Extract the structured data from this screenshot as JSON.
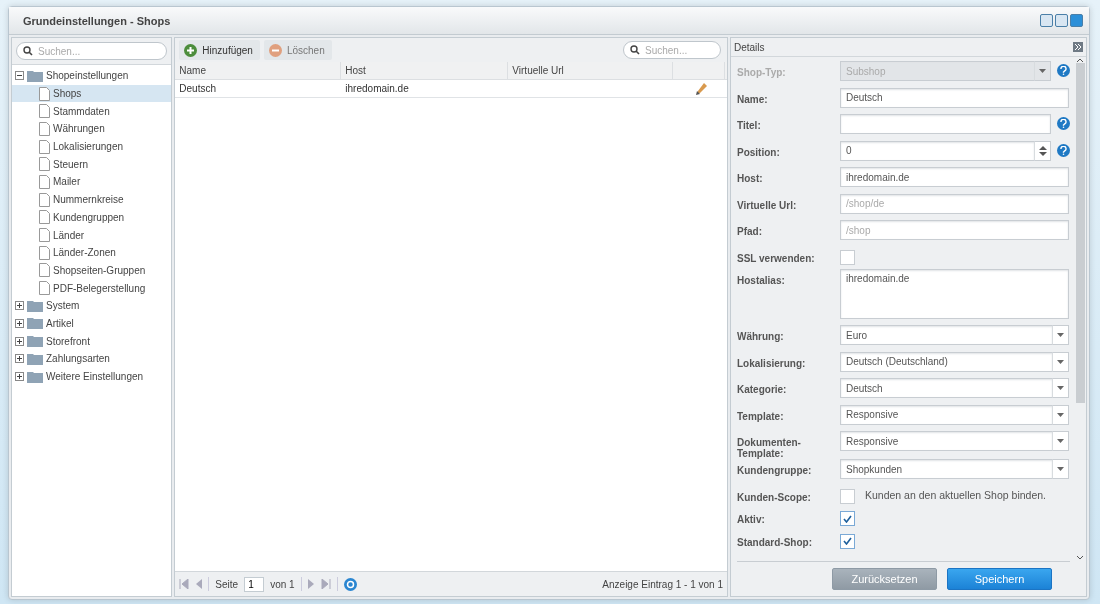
{
  "window": {
    "title": "Grundeinstellungen - Shops"
  },
  "tree": {
    "search": {
      "placeholder": "Suchen..."
    },
    "items": [
      {
        "label": "Shopeinstellungen",
        "expanded": true,
        "selected": false,
        "children": [
          {
            "label": "Shops",
            "selected": true
          },
          {
            "label": "Stammdaten",
            "selected": false
          },
          {
            "label": "Währungen",
            "selected": false
          },
          {
            "label": "Lokalisierungen",
            "selected": false
          },
          {
            "label": "Steuern",
            "selected": false
          },
          {
            "label": "Mailer",
            "selected": false
          },
          {
            "label": "Nummernkreise",
            "selected": false
          },
          {
            "label": "Kundengruppen",
            "selected": false
          },
          {
            "label": "Länder",
            "selected": false
          },
          {
            "label": "Länder-Zonen",
            "selected": false
          },
          {
            "label": "Shopseiten-Gruppen",
            "selected": false
          },
          {
            "label": "PDF-Belegerstellung",
            "selected": false
          }
        ]
      },
      {
        "label": "System",
        "expanded": false,
        "selected": false
      },
      {
        "label": "Artikel",
        "expanded": false,
        "selected": false
      },
      {
        "label": "Storefront",
        "expanded": false,
        "selected": false
      },
      {
        "label": "Zahlungsarten",
        "expanded": false,
        "selected": false
      },
      {
        "label": "Weitere Einstellungen",
        "expanded": false,
        "selected": false
      }
    ]
  },
  "toolbar": {
    "buttons": [
      {
        "label": "Hinzufügen",
        "kind": "add",
        "disabled": false
      },
      {
        "label": "Löschen",
        "kind": "delete",
        "disabled": true
      }
    ],
    "search": {
      "placeholder": "Suchen..."
    }
  },
  "table": {
    "columns": [
      "Name",
      "Host",
      "Virtuelle Url"
    ],
    "rows": [
      {
        "cells": [
          "Deutsch",
          "ihredomain.de",
          ""
        ],
        "selected": false
      }
    ]
  },
  "pager": {
    "page_label": "Seite",
    "page": "1",
    "of": "von 1",
    "summary": "Anzeige Eintrag 1 - 1 von 1"
  },
  "details": {
    "title": "Details",
    "fields": [
      {
        "label": "Shop-Typ:",
        "kind": "combo",
        "value": "Subshop",
        "disabled": true,
        "help": true
      },
      {
        "label": "Name:",
        "kind": "text",
        "value": "Deutsch"
      },
      {
        "label": "Titel:",
        "kind": "text",
        "help": true
      },
      {
        "label": "Position:",
        "kind": "spinner",
        "value": "0",
        "help": true
      },
      {
        "label": "Host:",
        "kind": "text",
        "value": "ihredomain.de"
      },
      {
        "label": "Virtuelle Url:",
        "kind": "text",
        "placeholder": "/shop/de"
      },
      {
        "label": "Pfad:",
        "kind": "text",
        "placeholder": "/shop"
      },
      {
        "label": "SSL verwenden:",
        "kind": "checkbox",
        "checked": false
      },
      {
        "label": "Hostalias:",
        "kind": "textarea",
        "value": "ihredomain.de"
      },
      {
        "label": "Währung:",
        "kind": "combo",
        "value": "Euro"
      },
      {
        "label": "Lokalisierung:",
        "kind": "combo",
        "value": "Deutsch (Deutschland)"
      },
      {
        "label": "Kategorie:",
        "kind": "combo",
        "value": "Deutsch"
      },
      {
        "label": "Template:",
        "kind": "combo",
        "value": "Responsive"
      },
      {
        "label": "Dokumenten-Template:",
        "kind": "combo",
        "value": "Responsive"
      },
      {
        "label": "Kundengruppe:",
        "kind": "combo",
        "value": "Shopkunden"
      },
      {
        "label": "Kunden-Scope:",
        "kind": "checkbox",
        "checked": false,
        "box_label": "Kunden an den aktuellen Shop binden."
      },
      {
        "label": "Aktiv:",
        "kind": "checkbox",
        "checked": true
      },
      {
        "label": "Standard-Shop:",
        "kind": "checkbox",
        "checked": true
      }
    ],
    "buttons": [
      {
        "label": "Zurücksetzen",
        "kind": "secondary"
      },
      {
        "label": "Speichern",
        "kind": "primary"
      }
    ]
  }
}
